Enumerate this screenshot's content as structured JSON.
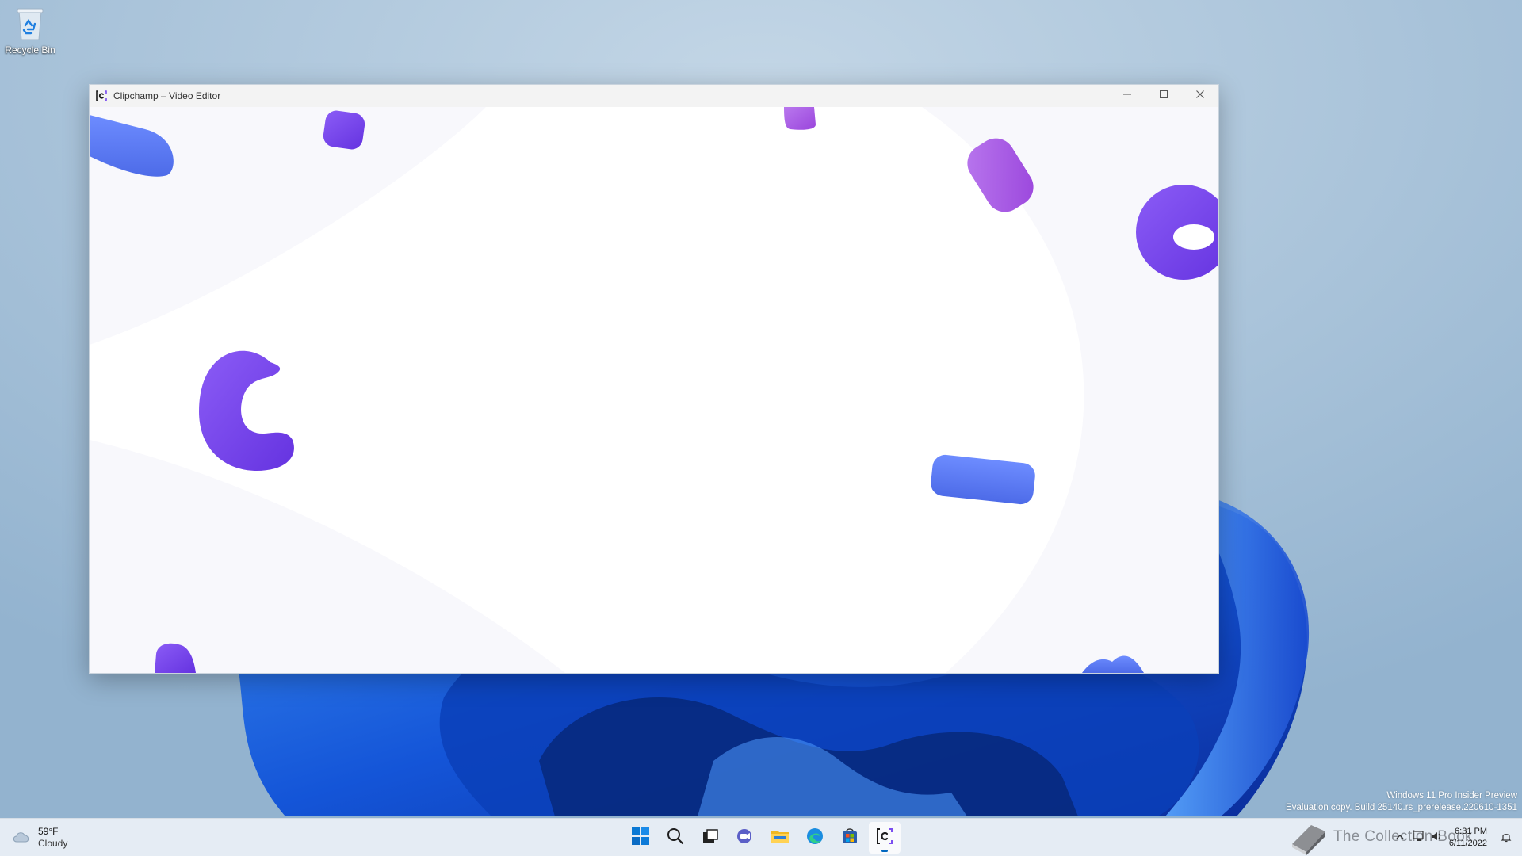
{
  "desktop": {
    "icons": [
      {
        "label": "Recycle Bin"
      }
    ],
    "watermark": {
      "line1": "Windows 11 Pro Insider Preview",
      "line2": "Evaluation copy. Build 25140.rs_prerelease.220610-1351"
    }
  },
  "window": {
    "title": "Clipchamp – Video Editor",
    "controls": {
      "minimize": "minimize-icon",
      "maximize": "maximize-icon",
      "close": "close-icon"
    },
    "accent_colors": {
      "purple": "#7b4ef0",
      "blue": "#5b7df5",
      "violet": "#a857e6"
    }
  },
  "taskbar": {
    "weather": {
      "temperature": "59°F",
      "condition": "Cloudy"
    },
    "pinned": [
      {
        "name": "start",
        "icon": "windows-start-icon"
      },
      {
        "name": "search",
        "icon": "search-icon"
      },
      {
        "name": "task-view",
        "icon": "task-view-icon"
      },
      {
        "name": "chat",
        "icon": "teams-chat-icon"
      },
      {
        "name": "file-explorer",
        "icon": "folder-icon"
      },
      {
        "name": "edge",
        "icon": "edge-icon"
      },
      {
        "name": "store",
        "icon": "store-icon"
      },
      {
        "name": "clipchamp",
        "icon": "clipchamp-icon",
        "active": true
      }
    ],
    "tray": {
      "overlay_text": "The Collection Book",
      "time": "6:31 PM",
      "date": "6/11/2022"
    }
  }
}
